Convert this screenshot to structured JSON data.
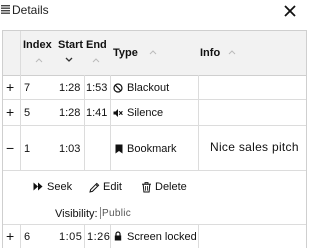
{
  "panel": {
    "title": "Details",
    "close_label": "×"
  },
  "columns": {
    "index": "Index",
    "start": "Start",
    "end": "End",
    "type": "Type",
    "info": "Info"
  },
  "rows": [
    {
      "expander": "+",
      "index": "7",
      "start": "1:28",
      "end": "1:53",
      "type": "Blackout",
      "type_icon": "blackout-icon",
      "info": ""
    },
    {
      "expander": "+",
      "index": "5",
      "start": "1:28",
      "end": "1:41",
      "type": "Silence",
      "type_icon": "mute-icon",
      "info": ""
    },
    {
      "expander": "−",
      "index": "1",
      "start": "1:03",
      "end": "",
      "type": "Bookmark",
      "type_icon": "bookmark-icon",
      "info": "Nice sales pitch"
    },
    {
      "expander": "+",
      "index": "6",
      "start": "1:05",
      "end": "1:26",
      "type": "Screen locked",
      "type_icon": "lock-icon",
      "info": ""
    }
  ],
  "detail": {
    "seek_label": "Seek",
    "edit_label": "Edit",
    "delete_label": "Delete",
    "visibility_label": "Visibility:",
    "visibility_value": "Public"
  },
  "colors": {
    "header_bg": "#f2f2f2",
    "border": "#cfcfcf"
  }
}
